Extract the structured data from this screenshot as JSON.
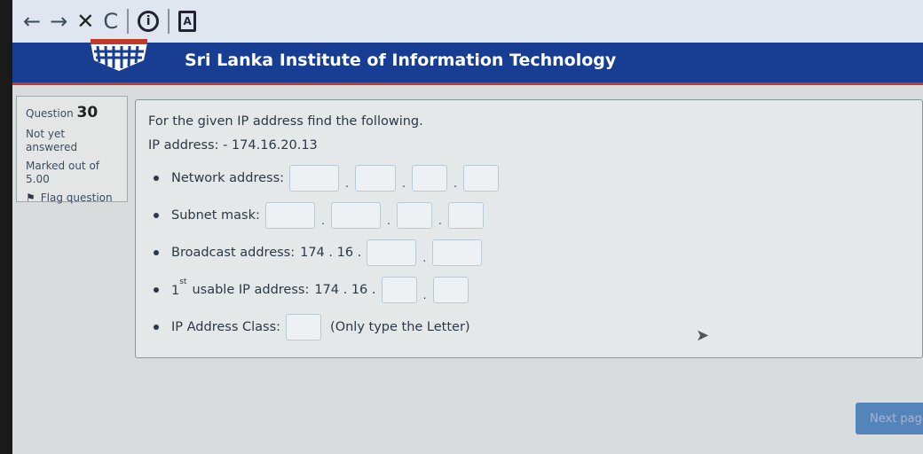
{
  "browser": {
    "back_icon": "←",
    "forward_icon": "→",
    "close_icon": "✕",
    "refresh_icon": "C",
    "info_icon": "i",
    "doc_icon": "A"
  },
  "banner": {
    "title": "Sri Lanka Institute of Information Technology"
  },
  "question_info": {
    "label": "Question",
    "number": "30",
    "status": "Not yet answered",
    "marked": "Marked out of",
    "score": "5.00",
    "flag": "Flag question"
  },
  "question": {
    "intro": "For the given IP address find the following.",
    "ip_line": "IP address: - 174.16.20.13",
    "network_label": "Network address:",
    "subnet_label": "Subnet mask:",
    "broadcast_label": "Broadcast address:",
    "broadcast_prefix": "174 . 16 .",
    "usable_label_pre": "1",
    "usable_sup": "st",
    "usable_label": "usable IP address:",
    "usable_prefix": "174 . 16 .",
    "class_label": "IP Address Class:",
    "class_hint": "(Only type the Letter)",
    "dot": "."
  },
  "next_button": "Next page"
}
